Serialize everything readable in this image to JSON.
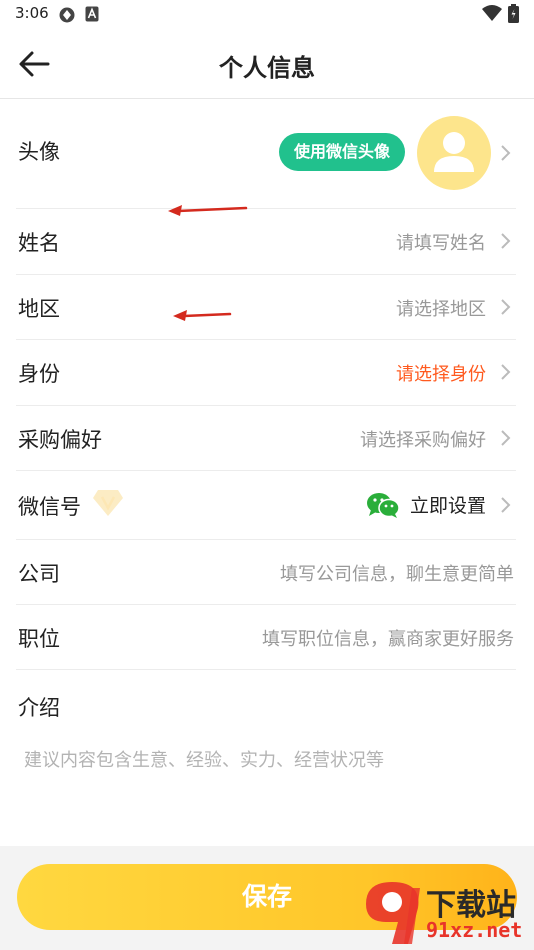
{
  "status_bar": {
    "time": "3:06",
    "icons": [
      "sync-icon",
      "a-icon",
      "wifi-icon",
      "battery-icon"
    ]
  },
  "header": {
    "title": "个人信息",
    "back_icon": "arrow-left-icon"
  },
  "rows": {
    "avatar": {
      "label": "头像",
      "wechat_avatar_button": "使用微信头像"
    },
    "name": {
      "label": "姓名",
      "placeholder": "请填写姓名"
    },
    "region": {
      "label": "地区",
      "placeholder": "请选择地区"
    },
    "identity": {
      "label": "身份",
      "placeholder": "请选择身份",
      "color": "#ff5a1f"
    },
    "purchase_pref": {
      "label": "采购偏好",
      "placeholder": "请选择采购偏好"
    },
    "wechat_id": {
      "label": "微信号",
      "action": "立即设置"
    },
    "company": {
      "label": "公司",
      "placeholder": "填写公司信息，聊生意更简单"
    },
    "position": {
      "label": "职位",
      "placeholder": "填写职位信息，赢商家更好服务"
    },
    "intro": {
      "label": "介绍",
      "placeholder": "建议内容包含生意、经验、实力、经营状况等"
    }
  },
  "footer": {
    "save_label": "保存"
  },
  "watermark": {
    "brand": "下载站",
    "url": "91xz.net"
  },
  "colors": {
    "accent_green": "#21c18d",
    "save_gradient_start": "#ffd840",
    "save_gradient_end": "#ffb31a",
    "annotation_arrow": "#d42a1e"
  }
}
